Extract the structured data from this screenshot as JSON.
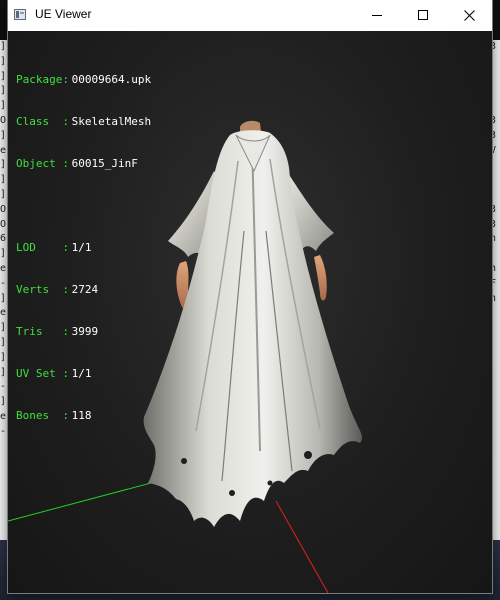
{
  "window": {
    "title": "UE Viewer"
  },
  "mesh_info": {
    "package_label": "Package:",
    "package": "00009664.upk",
    "class_label": "Class  :",
    "class": "SkeletalMesh",
    "object_label": "Object :",
    "object": "60015_JinF",
    "lod_label": "LOD    :",
    "lod": "1/1",
    "verts_label": "Verts  :",
    "verts": "2724",
    "tris_label": "Tris   :",
    "tris": "3999",
    "uvset_label": "UV Set :",
    "uvset": "1/1",
    "bones_label": "Bones  :",
    "bones": "118"
  },
  "colors": {
    "info_label": "#3ee03e",
    "info_value": "#ffffff",
    "axis_x": "#e02020",
    "axis_y": "#20d020",
    "viewport_bg": "#1e1e1e"
  },
  "background_console": {
    "left_chars": [
      "]",
      "]",
      "]",
      "]",
      "]",
      "O",
      "]",
      "e",
      "]",
      "]",
      "]",
      "O",
      "O",
      "6",
      "]",
      "e",
      "-",
      "]",
      "e",
      "]",
      "]",
      "]",
      "]",
      "-",
      "]",
      "e",
      "-"
    ],
    "right_chars": [
      "3",
      "",
      "",
      "",
      "",
      "3",
      "3",
      "V",
      "",
      "",
      "",
      "3",
      "3",
      "n",
      "",
      "n",
      "F",
      "n",
      "",
      "",
      "",
      "",
      "",
      "",
      "",
      "",
      ""
    ]
  }
}
